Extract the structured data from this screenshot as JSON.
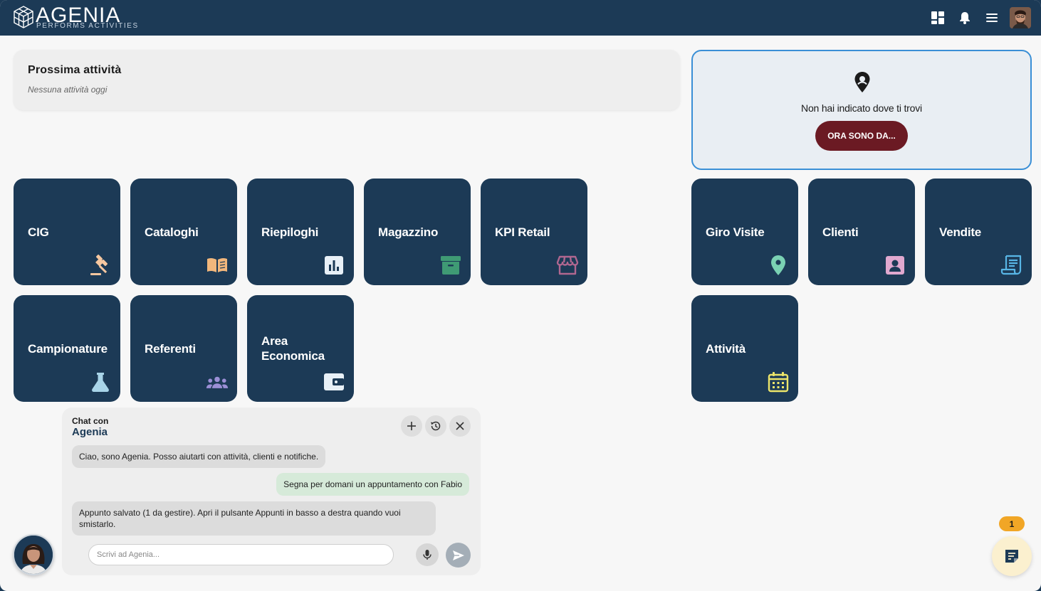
{
  "header": {
    "brand": "AGENIA",
    "tagline": "PERFORMS ACTIVITIES",
    "icons": [
      "dashboard-icon",
      "bell-icon",
      "menu-icon",
      "user-avatar"
    ]
  },
  "next_activity": {
    "title": "Prossima attività",
    "subtitle": "Nessuna attività oggi"
  },
  "location": {
    "message": "Non hai indicato dove ti trovi",
    "button_label": "ORA SONO DA..."
  },
  "tiles_left": [
    {
      "label": "CIG",
      "icon": "gavel-icon",
      "color": "#f5c7a0"
    },
    {
      "label": "Cataloghi",
      "icon": "book-open-icon",
      "color": "#f2b77c"
    },
    {
      "label": "Riepiloghi",
      "icon": "bar-chart-icon",
      "color": "#e8f0f7"
    },
    {
      "label": "Magazzino",
      "icon": "archive-box-icon",
      "color": "#3f9a74"
    },
    {
      "label": "KPI Retail",
      "icon": "storefront-icon",
      "color": "#b06790"
    },
    {
      "label": "Campionature",
      "icon": "flask-icon",
      "color": "#a8d4e8"
    },
    {
      "label": "Referenti",
      "icon": "group-icon",
      "color": "#9b8fd6"
    },
    {
      "label": "Area Economica",
      "icon": "wallet-icon",
      "color": "#e8f0f7"
    }
  ],
  "tiles_right": [
    {
      "label": "Giro Visite",
      "icon": "map-pin-icon",
      "color": "#7ad1b3"
    },
    {
      "label": "Clienti",
      "icon": "contact-card-icon",
      "color": "#e0a8cf"
    },
    {
      "label": "Vendite",
      "icon": "receipt-icon",
      "color": "#58b6e6"
    },
    {
      "label": "Attività",
      "icon": "calendar-icon",
      "color": "#ece56a"
    }
  ],
  "chat": {
    "header_small": "Chat con",
    "header_name": "Agenia",
    "messages": [
      {
        "from": "bot",
        "text": "Ciao, sono Agenia. Posso aiutarti con attività, clienti e notifiche."
      },
      {
        "from": "user",
        "text": "Segna per domani un appuntamento con Fabio"
      },
      {
        "from": "bot",
        "text": "Appunto salvato (1 da gestire). Apri il pulsante Appunti in basso a destra quando vuoi smistarlo."
      }
    ],
    "input_placeholder": "Scrivi ad Agenia...",
    "input_value": ""
  },
  "notes": {
    "badge_count": "1"
  }
}
